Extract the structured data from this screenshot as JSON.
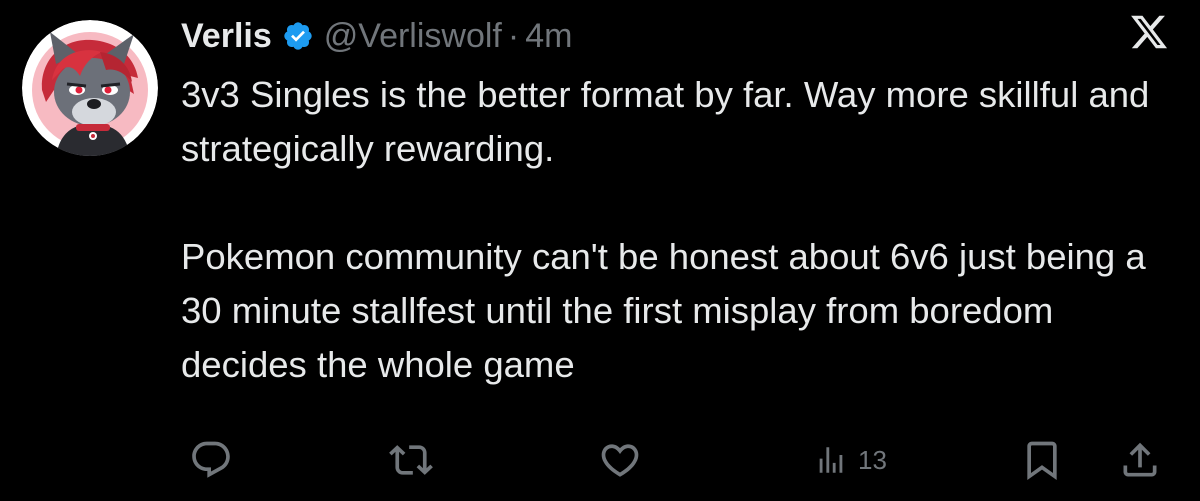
{
  "author": {
    "display_name": "Verlis",
    "handle": "@Verliswolf",
    "separator": "·",
    "time": "4m",
    "avatar_icon": "wolf-avatar",
    "verified_color": "#1d9bf0"
  },
  "tweet": {
    "paragraphs": [
      "3v3 Singles is the better format by far. Way more skillful and strategically rewarding.",
      "Pokemon community can't be honest about 6v6 just being a 30 minute stallfest until the first misplay from boredom decides the whole game"
    ]
  },
  "brand_icon": "x-logo-icon",
  "actions": {
    "reply_icon": "reply-icon",
    "repost_icon": "repost-icon",
    "like_icon": "like-icon",
    "views_icon": "views-icon",
    "views_count": "13",
    "bookmark_icon": "bookmark-icon",
    "share_icon": "share-icon"
  },
  "colors": {
    "background": "#000000",
    "text": "#e7e9ea",
    "secondary_text": "#71767b"
  }
}
